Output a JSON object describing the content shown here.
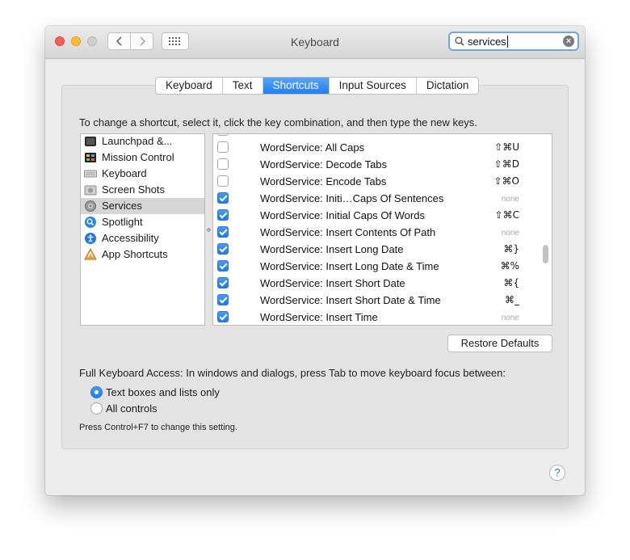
{
  "window": {
    "title": "Keyboard"
  },
  "search": {
    "value": "services"
  },
  "tabs": [
    {
      "label": "Keyboard",
      "active": false
    },
    {
      "label": "Text",
      "active": false
    },
    {
      "label": "Shortcuts",
      "active": true
    },
    {
      "label": "Input Sources",
      "active": false
    },
    {
      "label": "Dictation",
      "active": false
    }
  ],
  "instructions": "To change a shortcut, select it, click the key combination, and then type the new keys.",
  "categories": [
    {
      "label": "Launchpad &...",
      "icon": "launchpad-icon"
    },
    {
      "label": "Mission Control",
      "icon": "mission-control-icon"
    },
    {
      "label": "Keyboard",
      "icon": "keyboard-icon"
    },
    {
      "label": "Screen Shots",
      "icon": "screenshot-icon"
    },
    {
      "label": "Services",
      "icon": "gear-icon",
      "selected": true
    },
    {
      "label": "Spotlight",
      "icon": "spotlight-icon"
    },
    {
      "label": "Accessibility",
      "icon": "accessibility-icon"
    },
    {
      "label": "App Shortcuts",
      "icon": "app-shortcuts-icon"
    }
  ],
  "shortcuts": [
    {
      "name": "WordService: All Caps",
      "key": "⇧⌘U",
      "checked": false
    },
    {
      "name": "WordService: Decode Tabs",
      "key": "⇧⌘D",
      "checked": false
    },
    {
      "name": "WordService: Encode Tabs",
      "key": "⇧⌘O",
      "checked": false
    },
    {
      "name": "WordService: Initi…Caps Of Sentences",
      "key": "none",
      "checked": true
    },
    {
      "name": "WordService: Initial Caps Of Words",
      "key": "⇧⌘C",
      "checked": true
    },
    {
      "name": "WordService: Insert Contents Of Path",
      "key": "none",
      "checked": true
    },
    {
      "name": "WordService: Insert Long Date",
      "key": "⌘}",
      "checked": true
    },
    {
      "name": "WordService: Insert Long Date & Time",
      "key": "⌘%",
      "checked": true
    },
    {
      "name": "WordService: Insert Short Date",
      "key": "⌘{",
      "checked": true
    },
    {
      "name": "WordService: Insert Short Date & Time",
      "key": "⌘_",
      "checked": true
    },
    {
      "name": "WordService: Insert Time",
      "key": "none",
      "checked": true
    }
  ],
  "restore_label": "Restore Defaults",
  "full_keyboard_access": "Full Keyboard Access: In windows and dialogs, press Tab to move keyboard focus between:",
  "radio_options": [
    {
      "label": "Text boxes and lists only",
      "selected": true
    },
    {
      "label": "All controls",
      "selected": false
    }
  ],
  "hint": "Press Control+F7 to change this setting.",
  "help_label": "?",
  "colors": {
    "accent": "#1f7ff0",
    "selection": "#d5d5d5",
    "close": "#fc5f57",
    "minimize": "#fdbc2e"
  }
}
